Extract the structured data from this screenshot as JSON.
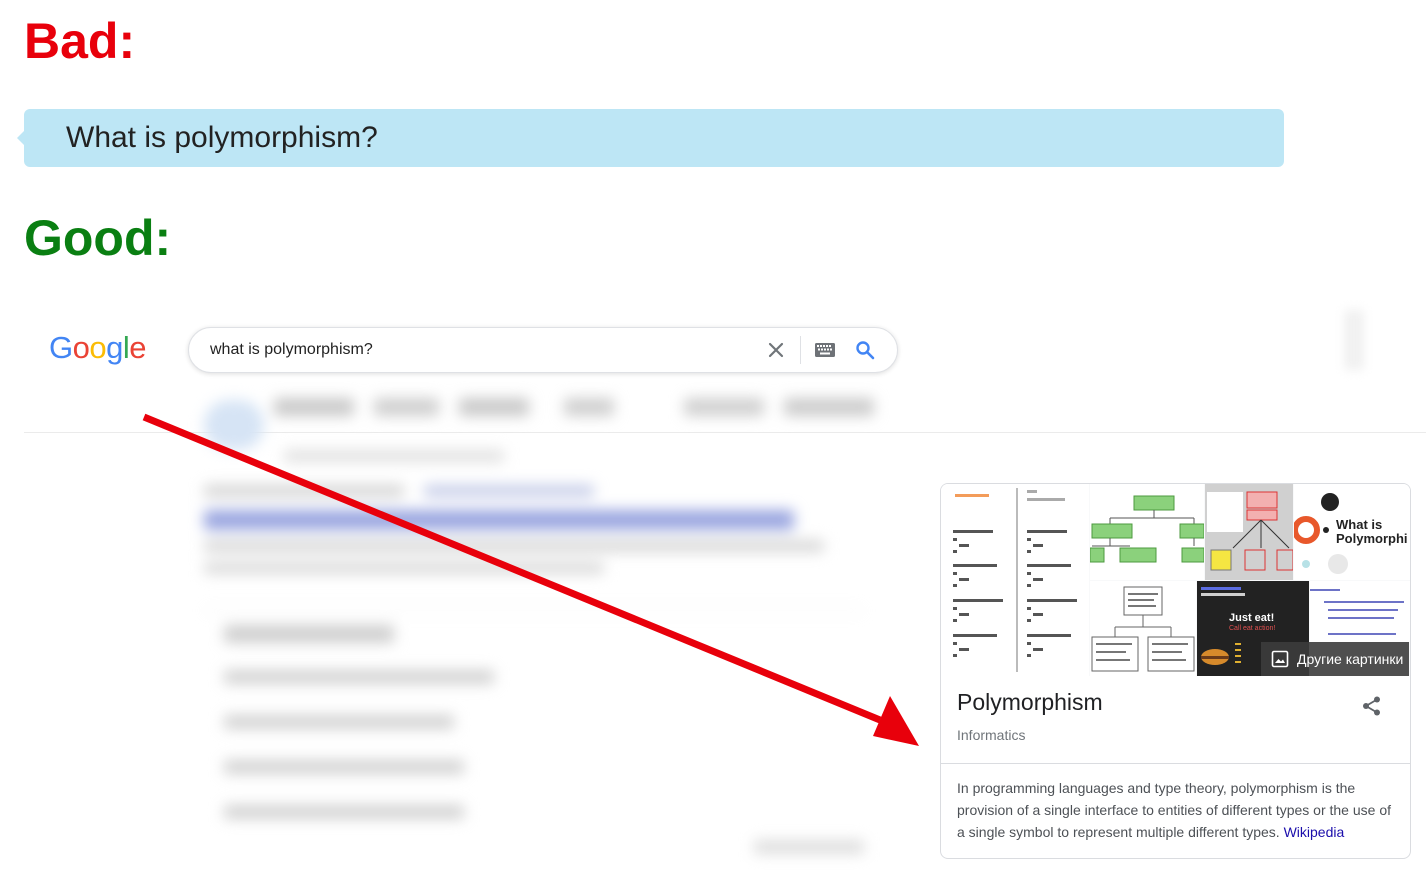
{
  "headings": {
    "bad": "Bad:",
    "good": "Good:"
  },
  "bad_example": {
    "query": "What is polymorphism?"
  },
  "google": {
    "logo": [
      "G",
      "o",
      "o",
      "g",
      "l",
      "e"
    ],
    "logo_colors": [
      "#4285f4",
      "#ea4335",
      "#fbbc05",
      "#4285f4",
      "#34a853",
      "#ea4335"
    ],
    "search_value": "what is polymorphism?"
  },
  "knowledge_panel": {
    "more_images_label": "Другие картинки",
    "title": "Polymorphism",
    "subtitle": "Informatics",
    "description": "In programming languages and type theory, polymorphism is the provision of a single interface to entities of different types or the use of a single symbol to represent multiple different types.",
    "source_link": "Wikipedia",
    "image_captions": {
      "tile4": "What is Polymorphi",
      "tile6_title": "Just eat!",
      "tile6_sub": "Call eat action!"
    }
  },
  "colors": {
    "bad": "#e8000b",
    "good": "#0a7f12",
    "arrow": "#e8000b",
    "bubble": "#bde6f5",
    "link": "#1a0dab"
  },
  "icons": [
    "clear-icon",
    "keyboard-icon",
    "search-icon",
    "images-icon",
    "share-icon"
  ]
}
